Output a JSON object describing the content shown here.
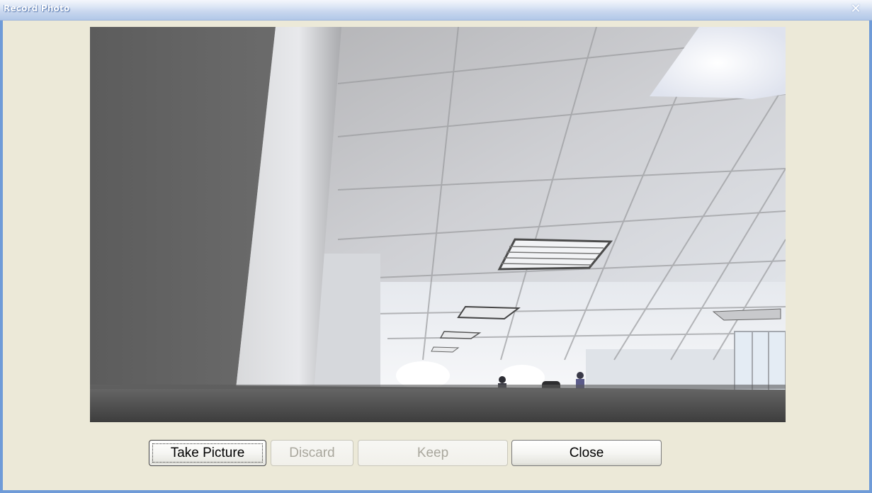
{
  "window": {
    "title": "Record Photo",
    "close_glyph": "✕"
  },
  "camera_preview": {
    "description_icon": "webcam-feed"
  },
  "buttons": {
    "take_picture": "Take Picture",
    "discard": "Discard",
    "keep": "Keep",
    "close": "Close"
  },
  "states": {
    "take_picture_enabled": true,
    "discard_enabled": false,
    "keep_enabled": false,
    "close_enabled": true
  },
  "colors": {
    "titlebar_text": "#ffffff",
    "dialog_bg": "#ece9d8",
    "disabled_text": "#a9a79d"
  }
}
